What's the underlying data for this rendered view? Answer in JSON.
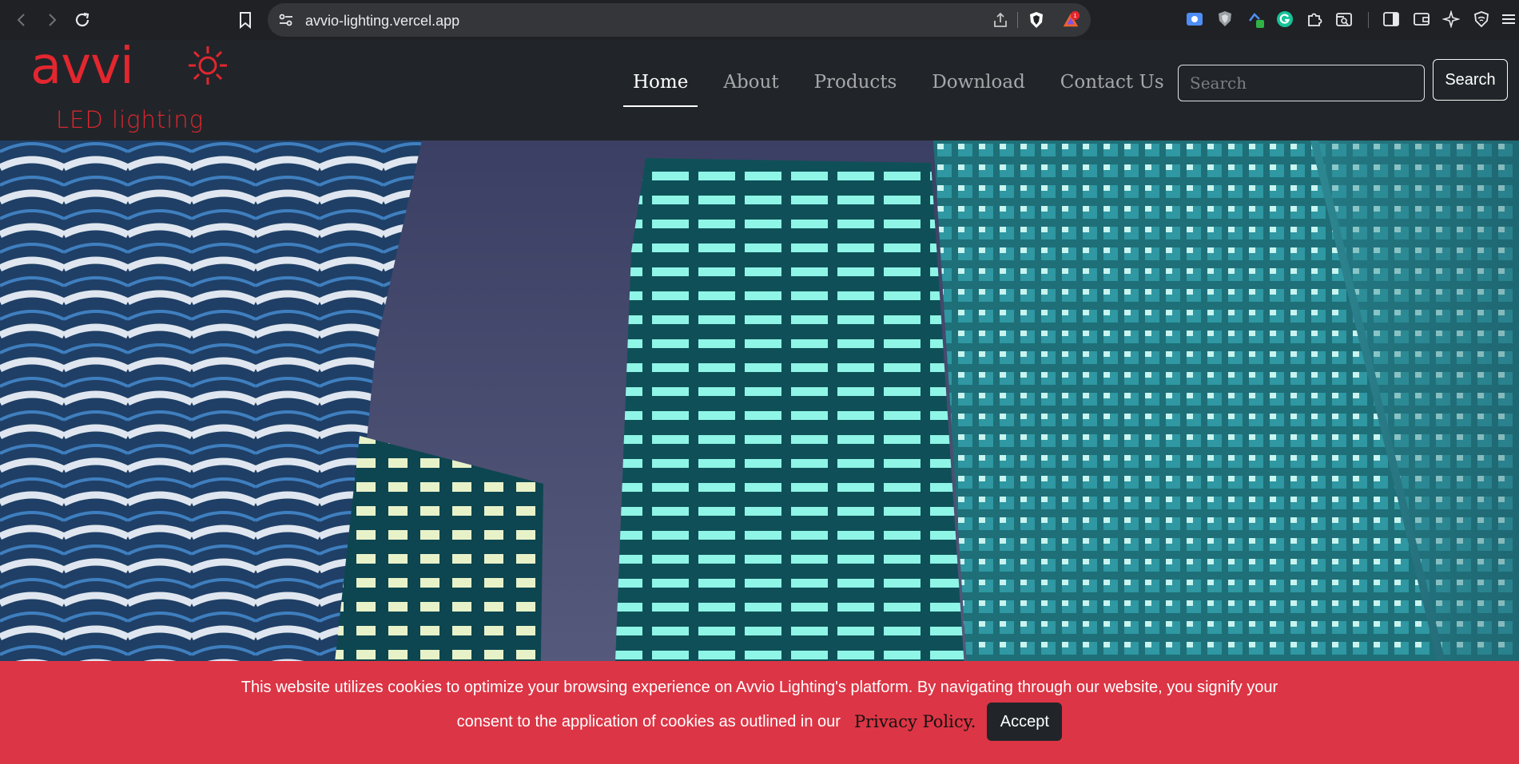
{
  "browser": {
    "url": "avvio-lighting.vercel.app",
    "notification_count": "1"
  },
  "logo": {
    "brand": "avvi",
    "tagline": "LED lighting"
  },
  "nav": {
    "items": [
      {
        "label": "Home",
        "active": true
      },
      {
        "label": "About",
        "active": false
      },
      {
        "label": "Products",
        "active": false
      },
      {
        "label": "Download",
        "active": false
      },
      {
        "label": "Contact Us",
        "active": false
      }
    ],
    "search_placeholder": "Search",
    "search_button": "Search"
  },
  "cookie": {
    "line1": "This website utilizes cookies to optimize your browsing experience on Avvio Lighting's platform. By navigating through our website, you signify your",
    "line2": "consent to the application of cookies as outlined in our",
    "policy_link": "Privacy Policy.",
    "accept": "Accept"
  },
  "colors": {
    "brand_red": "#e3262f",
    "nav_bg": "#212529",
    "banner_bg": "#dc3545"
  }
}
